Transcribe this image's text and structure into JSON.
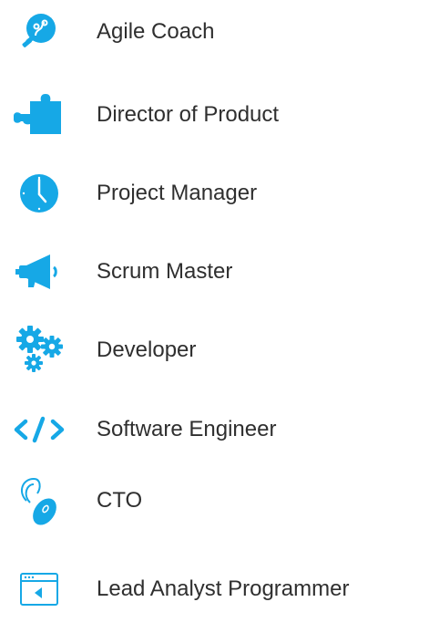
{
  "accent_color": "#16a8e6",
  "roles": [
    {
      "label": "Agile Coach",
      "icon": "lightbulb-icon"
    },
    {
      "label": "Director of Product",
      "icon": "puzzle-piece-icon"
    },
    {
      "label": "Project Manager",
      "icon": "clock-icon"
    },
    {
      "label": "Scrum Master",
      "icon": "megaphone-icon"
    },
    {
      "label": "Developer",
      "icon": "gears-icon"
    },
    {
      "label": "Software Engineer",
      "icon": "code-icon"
    },
    {
      "label": "CTO",
      "icon": "mouse-icon"
    },
    {
      "label": "Lead Analyst Programmer",
      "icon": "browser-window-icon"
    }
  ]
}
